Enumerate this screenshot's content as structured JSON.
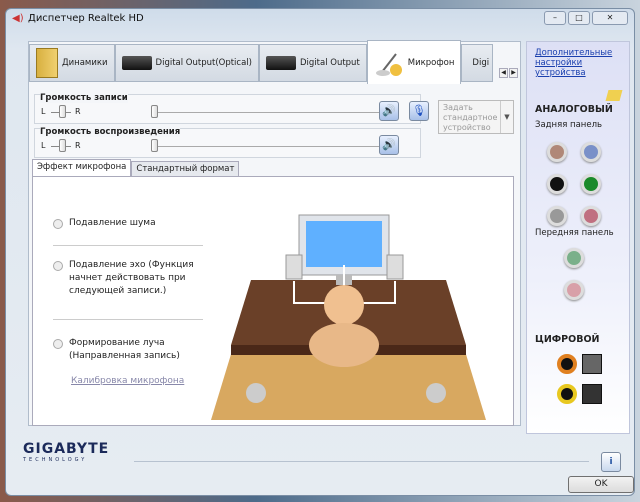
{
  "window": {
    "title": "Диспетчер Realtek HD",
    "minimize": "–",
    "maximize": "□",
    "close": "✕"
  },
  "tabs": [
    {
      "label": "Динамики"
    },
    {
      "label": "Digital Output(Optical)"
    },
    {
      "label": "Digital Output"
    },
    {
      "label": "Микрофон"
    },
    {
      "label": "Digi"
    }
  ],
  "recording": {
    "label": "Громкость записи",
    "left": "L",
    "right": "R"
  },
  "playback": {
    "label": "Громкость воспроизведения",
    "left": "L",
    "right": "R"
  },
  "set_default": "Задать стандартное устройство",
  "subtabs": [
    "Эффект микрофона",
    "Стандартный формат"
  ],
  "options": [
    {
      "label": "Подавление шума"
    },
    {
      "label": "Подавление эхо (Функция начнет действовать при следующей записи.)"
    },
    {
      "label": "Формирование луча (Направленная запись)"
    }
  ],
  "calibrate": "Калибровка микрофона",
  "side": {
    "link": "Дополнительные настройки устройства",
    "analog": "АНАЛОГОВЫЙ",
    "rear": "Задняя панель",
    "front": "Передняя панель",
    "digital": "ЦИФРОВОЙ",
    "rear_jacks": [
      "#b08878",
      "#7a90c8",
      "#111111",
      "#1a8a2a",
      "#999999",
      "#c07080"
    ],
    "front_jacks": [
      "#7ab08a",
      "#d8a0a8"
    ]
  },
  "footer": {
    "logo": "GIGABYTE",
    "logo_sub": "TECHNOLOGY",
    "info": "i",
    "ok": "OK"
  }
}
